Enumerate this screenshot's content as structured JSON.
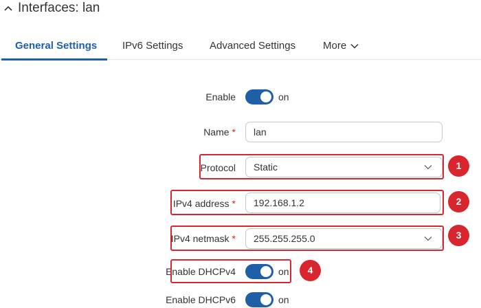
{
  "header": {
    "title": "Interfaces: lan"
  },
  "tabs": [
    {
      "label": "General Settings",
      "active": true
    },
    {
      "label": "IPv6 Settings"
    },
    {
      "label": "Advanced Settings"
    },
    {
      "label": "More"
    }
  ],
  "form": {
    "enable": {
      "label": "Enable",
      "state": "on"
    },
    "name": {
      "label": "Name",
      "required_mark": "*",
      "value": "lan"
    },
    "protocol": {
      "label": "Protocol",
      "value": "Static"
    },
    "ipv4_address": {
      "label": "IPv4 address",
      "required_mark": "*",
      "value": "192.168.1.2"
    },
    "ipv4_netmask": {
      "label": "IPv4 netmask",
      "required_mark": "*",
      "value": "255.255.255.0"
    },
    "enable_dhcpv4": {
      "label": "Enable DHCPv4",
      "state": "on"
    },
    "enable_dhcpv6": {
      "label": "Enable DHCPv6",
      "state": "on"
    }
  },
  "annotations": [
    "1",
    "2",
    "3",
    "4"
  ],
  "colors": {
    "accent": "#1f5fa8",
    "highlight": "#d8262e",
    "required": "#d3231b"
  }
}
